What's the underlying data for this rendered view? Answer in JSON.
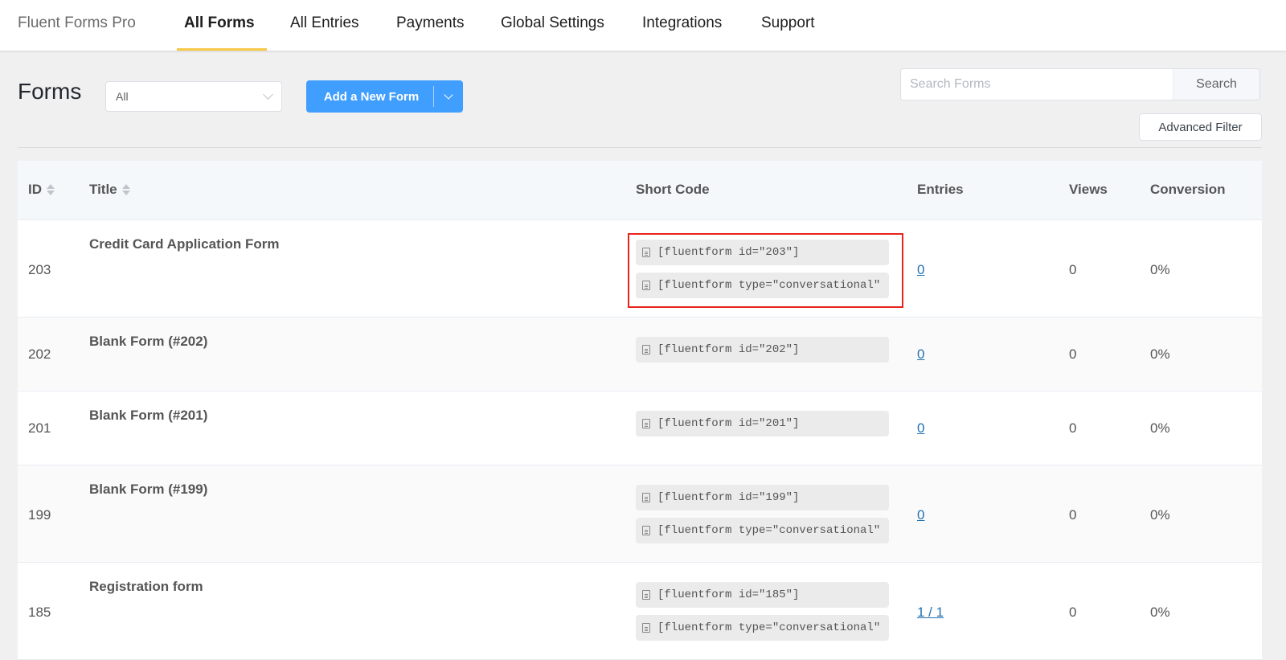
{
  "nav": {
    "brand": "Fluent Forms Pro",
    "items": [
      {
        "label": "All Forms",
        "active": true
      },
      {
        "label": "All Entries",
        "active": false
      },
      {
        "label": "Payments",
        "active": false
      },
      {
        "label": "Global Settings",
        "active": false
      },
      {
        "label": "Integrations",
        "active": false
      },
      {
        "label": "Support",
        "active": false
      }
    ],
    "active_underline_color": "#f7c948"
  },
  "header": {
    "title": "Forms",
    "filter_value": "All",
    "add_button_label": "Add a New Form",
    "search_placeholder": "Search Forms",
    "search_value": "",
    "search_button_label": "Search",
    "advanced_filter_label": "Advanced Filter"
  },
  "table": {
    "columns": {
      "id": "ID",
      "title": "Title",
      "short_code": "Short Code",
      "entries": "Entries",
      "views": "Views",
      "conversion": "Conversion"
    },
    "rows": [
      {
        "id": "203",
        "title": "Credit Card Application Form",
        "codes": [
          "[fluentform id=\"203\"]",
          "[fluentform type=\"conversational\""
        ],
        "entries": "0",
        "views": "0",
        "conversion": "0%"
      },
      {
        "id": "202",
        "title": "Blank Form (#202)",
        "codes": [
          "[fluentform id=\"202\"]"
        ],
        "entries": "0",
        "views": "0",
        "conversion": "0%"
      },
      {
        "id": "201",
        "title": "Blank Form (#201)",
        "codes": [
          "[fluentform id=\"201\"]"
        ],
        "entries": "0",
        "views": "0",
        "conversion": "0%"
      },
      {
        "id": "199",
        "title": "Blank Form (#199)",
        "codes": [
          "[fluentform id=\"199\"]",
          "[fluentform type=\"conversational\""
        ],
        "entries": "0",
        "views": "0",
        "conversion": "0%"
      },
      {
        "id": "185",
        "title": "Registration form",
        "codes": [
          "[fluentform id=\"185\"]",
          "[fluentform type=\"conversational\""
        ],
        "entries": "1 / 1",
        "views": "0",
        "conversion": "0%"
      }
    ]
  },
  "colors": {
    "primary": "#409eff",
    "link": "#2271b1",
    "highlight_box": "#e8231c"
  }
}
